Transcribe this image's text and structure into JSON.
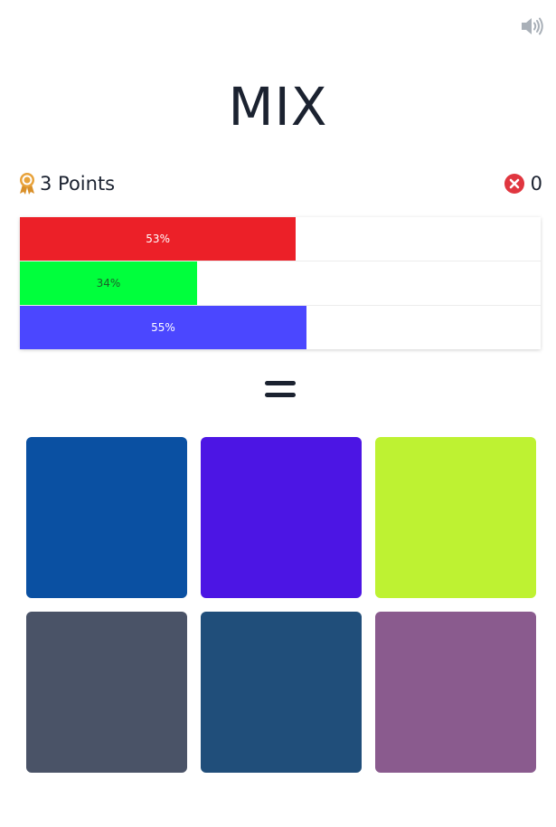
{
  "header": {
    "sound_icon": "volume-icon",
    "title": "MIX"
  },
  "score": {
    "points_label": "3 Points",
    "points_icon": "award-ribbon-icon",
    "errors_count": "0",
    "errors_icon": "error-x-circle-icon"
  },
  "target_bars": [
    {
      "channel": "red",
      "percent": 53,
      "label": "53%",
      "color": "#ec2028"
    },
    {
      "channel": "green",
      "percent": 34,
      "label": "34%",
      "color": "#00ff3c"
    },
    {
      "channel": "blue",
      "percent": 55,
      "label": "55%",
      "color": "#4b47ff"
    }
  ],
  "operator_icon": "equals-icon",
  "options": [
    {
      "color": "#0a50a2"
    },
    {
      "color": "#4c15e4"
    },
    {
      "color": "#bef232"
    },
    {
      "color": "#4a5367"
    },
    {
      "color": "#204e7a"
    },
    {
      "color": "#8a5b8e"
    }
  ]
}
